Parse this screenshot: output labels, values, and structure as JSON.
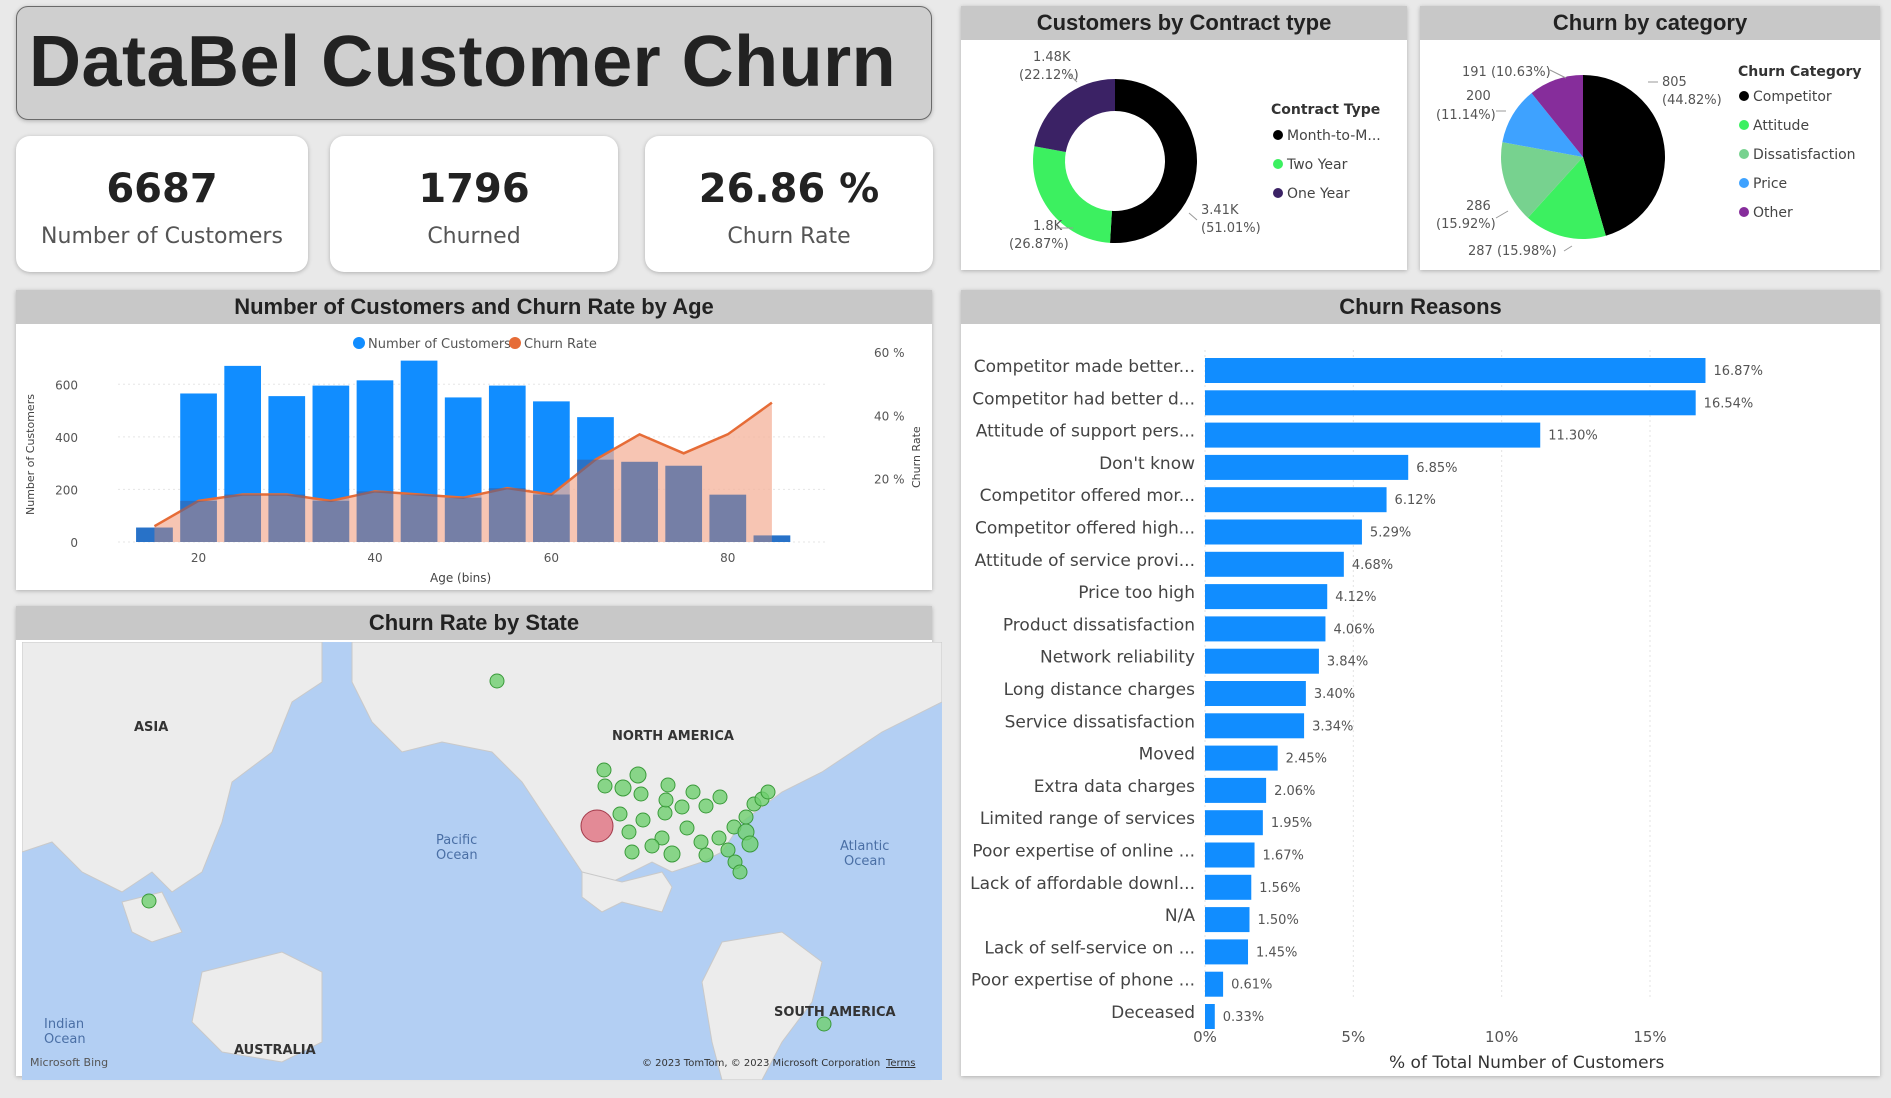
{
  "header": {
    "title": "DataBel Customer Churn"
  },
  "kpis": [
    {
      "value": "6687",
      "label": "Number of Customers"
    },
    {
      "value": "1796",
      "label": "Churned"
    },
    {
      "value": "26.86 %",
      "label": "Churn Rate"
    }
  ],
  "contract_panel": {
    "title": "Customers by Contract type",
    "legend_title": "Contract Type",
    "legend": [
      "Month-to-M...",
      "Two Year",
      "One Year"
    ],
    "label_month": [
      "3.41K",
      "(51.01%)"
    ],
    "label_two": [
      "1.8K",
      "(26.87%)"
    ],
    "label_one": [
      "1.48K",
      "(22.12%)"
    ]
  },
  "category_panel": {
    "title": "Churn by category",
    "legend_title": "Churn Category",
    "legend": [
      "Competitor",
      "Attitude",
      "Dissatisfaction",
      "Price",
      "Other"
    ],
    "label_competitor": [
      "805",
      "(44.82%)"
    ],
    "label_attitude": "287 (15.98%)",
    "label_dissatisfaction": [
      "286",
      "(15.92%)"
    ],
    "label_price": [
      "200",
      "(11.14%)"
    ],
    "label_other": "191 (10.63%)"
  },
  "age_panel": {
    "title": "Number of Customers and Churn Rate by Age",
    "legend": [
      "Number of Customers",
      "Churn Rate"
    ],
    "xlabel": "Age (bins)",
    "ylabel_left": "Number of Customers",
    "ylabel_right": "Churn Rate",
    "left_ticks": [
      "0",
      "200",
      "400",
      "600"
    ],
    "right_ticks": [
      "20 %",
      "40 %",
      "60 %"
    ],
    "x_ticks": [
      "20",
      "40",
      "60",
      "80"
    ]
  },
  "map_panel": {
    "title": "Churn Rate by State",
    "labels": {
      "asia": "ASIA",
      "north_america": "NORTH AMERICA",
      "pacific": [
        "Pacific",
        "Ocean"
      ],
      "atlantic": [
        "Atlantic",
        "Ocean"
      ],
      "indian": [
        "Indian",
        "Ocean"
      ],
      "australia": "AUSTRALIA",
      "south_america": "SOUTH AMERICA"
    },
    "bing": "Microsoft Bing",
    "copyright": "© 2023 TomTom, © 2023 Microsoft Corporation",
    "terms": "Terms"
  },
  "reasons_panel": {
    "title": "Churn Reasons",
    "x_ticks": [
      "0%",
      "5%",
      "10%",
      "15%"
    ]
  },
  "colors": {
    "blue": "#118dff",
    "orange": "#e66c37",
    "orange_fill": "#f4b19a",
    "black": "#000000",
    "green": "#3cf060",
    "purple": "#3b2265",
    "dissatisfaction": "#77d28f",
    "price": "#3ea2ff",
    "other": "#862d9b"
  },
  "chart_data": [
    {
      "type": "pie",
      "title": "Customers by Contract type",
      "style": "donut",
      "legend_title": "Contract Type",
      "categories": [
        "Month-to-M...",
        "Two Year",
        "One Year"
      ],
      "values": [
        3410,
        1800,
        1480
      ],
      "percent": [
        51.01,
        26.87,
        22.12
      ]
    },
    {
      "type": "pie",
      "title": "Churn by category",
      "legend_title": "Churn Category",
      "categories": [
        "Competitor",
        "Attitude",
        "Dissatisfaction",
        "Price",
        "Other"
      ],
      "values": [
        805,
        287,
        286,
        200,
        191
      ],
      "percent": [
        44.82,
        15.98,
        15.92,
        11.14,
        10.63
      ]
    },
    {
      "type": "bar",
      "title": "Number of Customers and Churn Rate by Age",
      "xlabel": "Age (bins)",
      "ylabel": "Number of Customers",
      "y2label": "Churn Rate",
      "x": [
        15,
        20,
        25,
        30,
        35,
        40,
        45,
        50,
        55,
        60,
        65,
        70,
        75,
        80,
        85
      ],
      "series": [
        {
          "name": "Number of Customers",
          "kind": "bar",
          "values": [
            55,
            565,
            670,
            555,
            595,
            615,
            690,
            550,
            595,
            535,
            475,
            305,
            290,
            180,
            25
          ]
        },
        {
          "name": "Churn Rate",
          "kind": "area",
          "axis": "right",
          "values": [
            5,
            13,
            15,
            15,
            13,
            16,
            15,
            14,
            17,
            15,
            26,
            34,
            28,
            34,
            44
          ]
        }
      ],
      "ylim": [
        0,
        700
      ],
      "y2lim": [
        0,
        60
      ],
      "xlim": [
        12,
        90
      ]
    },
    {
      "type": "bar",
      "orientation": "horizontal",
      "title": "Churn Reasons",
      "xlabel": "% of Total Number of Customers",
      "xlim": [
        0,
        18
      ],
      "categories": [
        "Competitor made better...",
        "Competitor had better d...",
        "Attitude of support pers...",
        "Don't know",
        "Competitor offered mor...",
        "Competitor offered high...",
        "Attitude of service provi...",
        "Price too high",
        "Product dissatisfaction",
        "Network reliability",
        "Long distance charges",
        "Service dissatisfaction",
        "Moved",
        "Extra data charges",
        "Limited range of services",
        "Poor expertise of online ...",
        "Lack of affordable downl...",
        "N/A",
        "Lack of self-service on ...",
        "Poor expertise of phone ...",
        "Deceased"
      ],
      "values": [
        16.87,
        16.54,
        11.3,
        6.85,
        6.12,
        5.29,
        4.68,
        4.12,
        4.06,
        3.84,
        3.4,
        3.34,
        2.45,
        2.06,
        1.95,
        1.67,
        1.56,
        1.5,
        1.45,
        0.61,
        0.33
      ],
      "labels": [
        "16.87%",
        "16.54%",
        "11.30%",
        "6.85%",
        "6.12%",
        "5.29%",
        "4.68%",
        "4.12%",
        "4.06%",
        "3.84%",
        "3.40%",
        "3.34%",
        "2.45%",
        "2.06%",
        "1.95%",
        "1.67%",
        "1.56%",
        "1.50%",
        "1.45%",
        "0.61%",
        "0.33%"
      ]
    }
  ]
}
